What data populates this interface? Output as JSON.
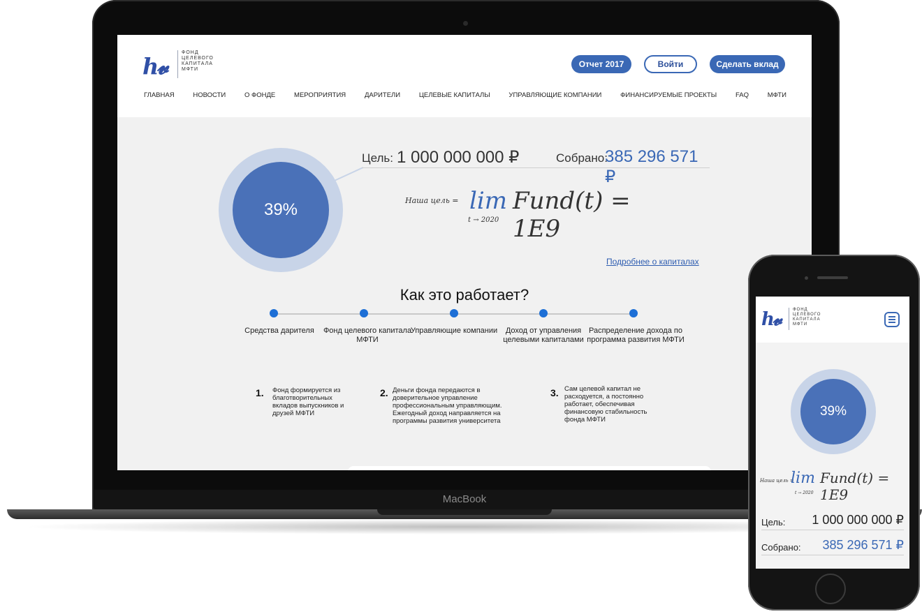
{
  "brand": {
    "logo_mark": "h𝓿",
    "logo_lines": [
      "ФОНД",
      "ЦЕЛЕВОГО",
      "КАПИТАЛА",
      "МФТИ"
    ]
  },
  "header": {
    "buttons": {
      "report": "Отчет 2017",
      "login": "Войти",
      "donate": "Сделать вклад"
    },
    "nav": [
      "ГЛАВНАЯ",
      "НОВОСТИ",
      "О ФОНДЕ",
      "МЕРОПРИЯТИЯ",
      "ДАРИТЕЛИ",
      "ЦЕЛЕВЫЕ КАПИТАЛЫ",
      "УПРАВЛЯЮЩИЕ КОМПАНИИ",
      "ФИНАНСИРУЕМЫЕ ПРОЕКТЫ",
      "FAQ",
      "МФТИ"
    ]
  },
  "progress": {
    "percent_label": "39%",
    "fraction": 0.39,
    "goal_label": "Цель:",
    "goal_value": "1 000 000 000 ₽",
    "raised_label": "Собрано:",
    "raised_value": "385 296 571 ₽"
  },
  "formula": {
    "prefix": "Наша цель =",
    "lim": "lim",
    "expression": "Fund(t) = 1E9",
    "subscript": "t → 2020"
  },
  "more_link": "Подробнее о капиталах",
  "how": {
    "title": "Как это работает?",
    "steps": [
      "Средства дарителя",
      "Фонд целевого капитала МФТИ",
      "Управляющие компании",
      "Доход от управления целевыми капиталами",
      "Распределение дохода по программа развития МФТИ"
    ],
    "points": [
      {
        "num": "1.",
        "text": "Фонд формируется из благотворительных вкладов выпускников и друзей МФТИ"
      },
      {
        "num": "2.",
        "text": "Деньги фонда передаются в доверительное управление профессиональным управляющим. Ежегодный доход направляется на программы развития университета"
      },
      {
        "num": "3.",
        "text": "Сам целевой капитал не расходуется, а постоянно работает, обеспечивая финансовую стабильность фонда МФТИ"
      }
    ]
  },
  "device": {
    "laptop_brand": "MacBook"
  },
  "colors": {
    "accent": "#3a68b5",
    "ring_outer": "#c8d4e8",
    "ring_inner": "#4a71b8",
    "step_dot": "#1d6fd6"
  },
  "icons": {
    "menu": "hamburger-menu-icon"
  }
}
